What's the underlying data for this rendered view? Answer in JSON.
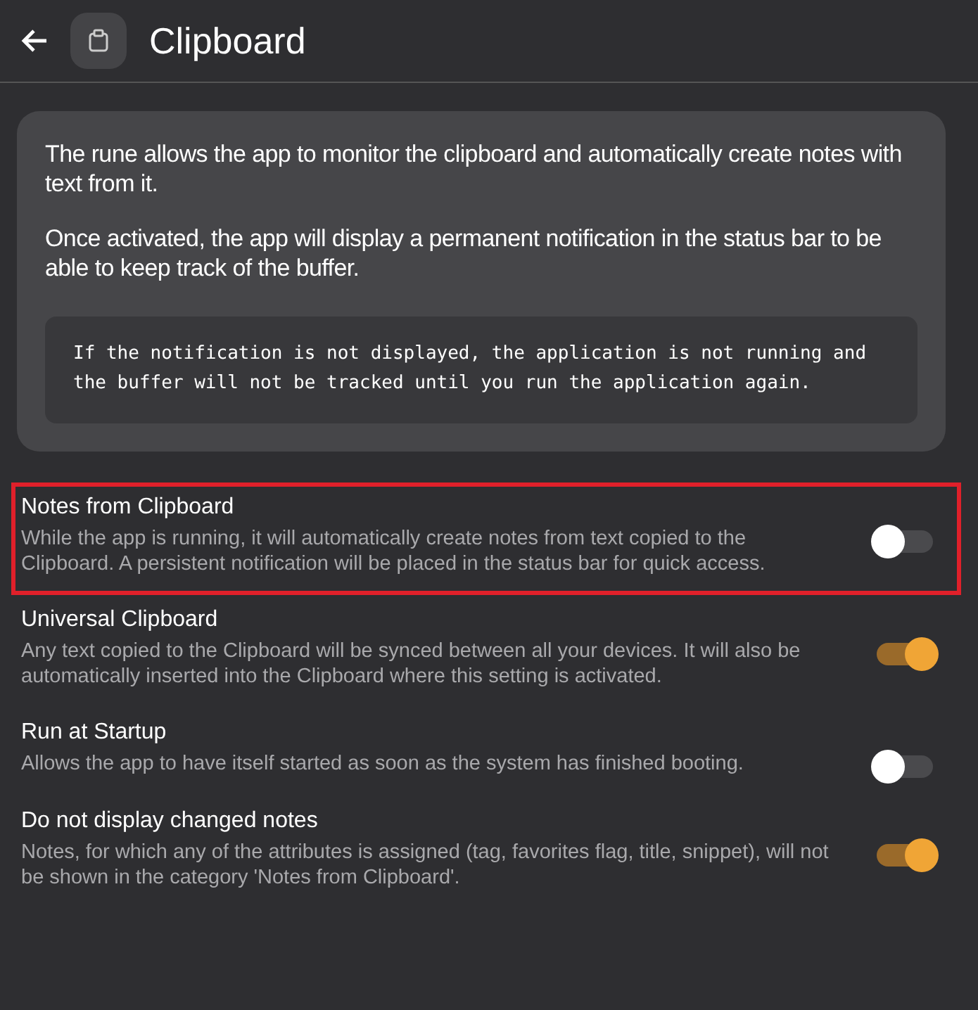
{
  "header": {
    "title": "Clipboard"
  },
  "info_card": {
    "paragraphs": [
      "The rune allows the app to monitor the clipboard and automatically create notes with text from it.",
      "Once activated, the app will display a permanent notification in the status bar to be able to keep track of the buffer."
    ],
    "code_note": "If the notification is not displayed, the application is not running and the buffer will not be tracked until you run the application again."
  },
  "settings": [
    {
      "title": "Notes from Clipboard",
      "description": "While the app is running, it will automatically create notes from text copied to the Clipboard. A persistent notification will be placed in the status bar for quick access.",
      "on": false,
      "highlighted": true
    },
    {
      "title": "Universal Clipboard",
      "description": "Any text copied to the Clipboard will be synced between all your devices. It will also be automatically inserted into the Clipboard where this setting is activated.",
      "on": true,
      "highlighted": false
    },
    {
      "title": "Run at Startup",
      "description": "Allows the app to have itself started as soon as the system has finished booting.",
      "on": false,
      "highlighted": false
    },
    {
      "title": "Do not display changed notes",
      "description": "Notes, for which any of the attributes is assigned (tag, favorites flag, title, snippet), will not be shown in the category 'Notes from Clipboard'.",
      "on": true,
      "highlighted": false
    }
  ]
}
